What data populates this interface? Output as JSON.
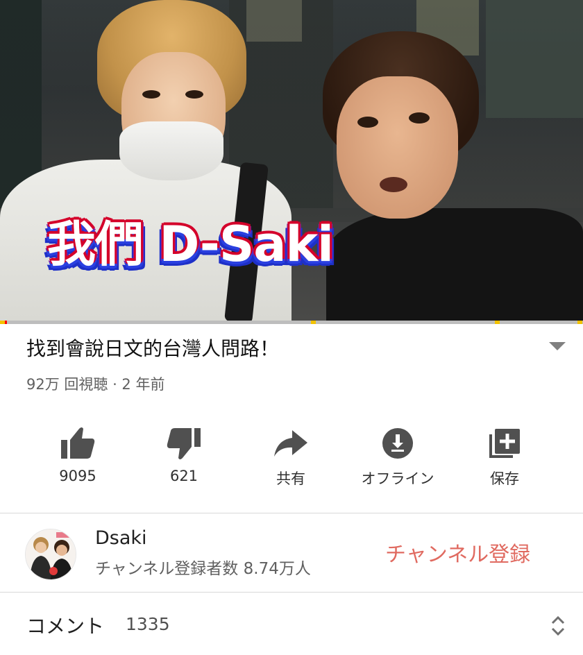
{
  "video": {
    "overlay_caption": "我們 D-Saki",
    "progress_fraction": 0.012
  },
  "details": {
    "title": "找到會說日文的台灣人問路！",
    "meta": "92万 回視聴 · 2 年前"
  },
  "actions": [
    {
      "icon": "thumbs-up-icon",
      "label": "9095"
    },
    {
      "icon": "thumbs-down-icon",
      "label": "621"
    },
    {
      "icon": "share-icon",
      "label": "共有"
    },
    {
      "icon": "download-icon",
      "label": "オフライン"
    },
    {
      "icon": "add-to-playlist-icon",
      "label": "保存"
    }
  ],
  "channel": {
    "name": "Dsaki",
    "subscribers": "チャンネル登録者数 8.74万人",
    "subscribe_label": "チャンネル登録"
  },
  "comments": {
    "label": "コメント",
    "count": "1335"
  },
  "colors": {
    "progress": "#ff0000",
    "subscribe": "#e06a60",
    "overlay_fill": "#ffffff",
    "overlay_outline_red": "#d4002a",
    "overlay_outline_blue": "#2a40e0"
  }
}
